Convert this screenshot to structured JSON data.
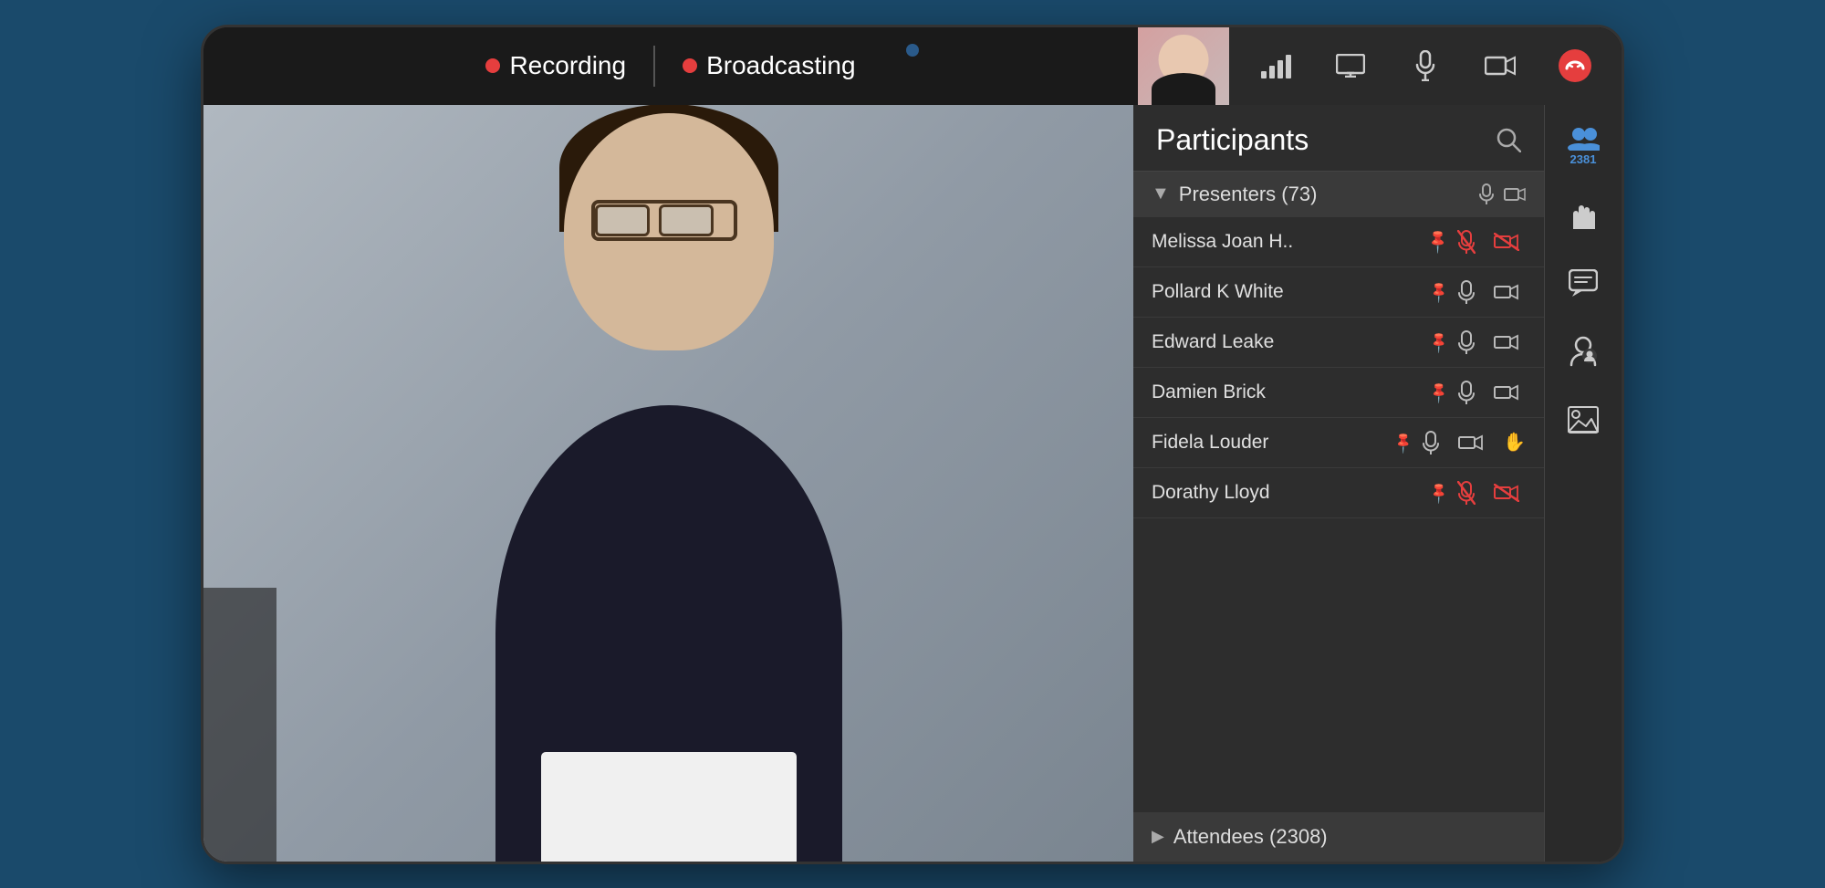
{
  "device": {
    "camera_label": "camera"
  },
  "topbar": {
    "recording_label": "Recording",
    "broadcasting_label": "Broadcasting"
  },
  "participants_panel": {
    "title": "Participants",
    "presenters_label": "Presenters (73)",
    "attendees_label": "Attendees (2308)",
    "participant_count": "2381",
    "participants": [
      {
        "name": "Melissa Joan H..",
        "mic": "off",
        "cam": "off"
      },
      {
        "name": "Pollard K White",
        "mic": "on",
        "cam": "on"
      },
      {
        "name": "Edward Leake",
        "mic": "on",
        "cam": "on"
      },
      {
        "name": "Damien Brick",
        "mic": "on",
        "cam": "on"
      },
      {
        "name": "Fidela Louder",
        "mic": "on",
        "cam": "on"
      },
      {
        "name": "Dorathy Lloyd",
        "mic": "off",
        "cam": "off"
      }
    ]
  },
  "sidebar_icons": {
    "participants_icon": "👥",
    "raise_hand_icon": "✋",
    "chat_icon": "💬",
    "person_icon": "👤",
    "image_icon": "🖼"
  },
  "colors": {
    "red": "#e53e3e",
    "blue": "#4a90d9",
    "panel_bg": "#2d2d2d",
    "section_bg": "#3a3a3a"
  }
}
